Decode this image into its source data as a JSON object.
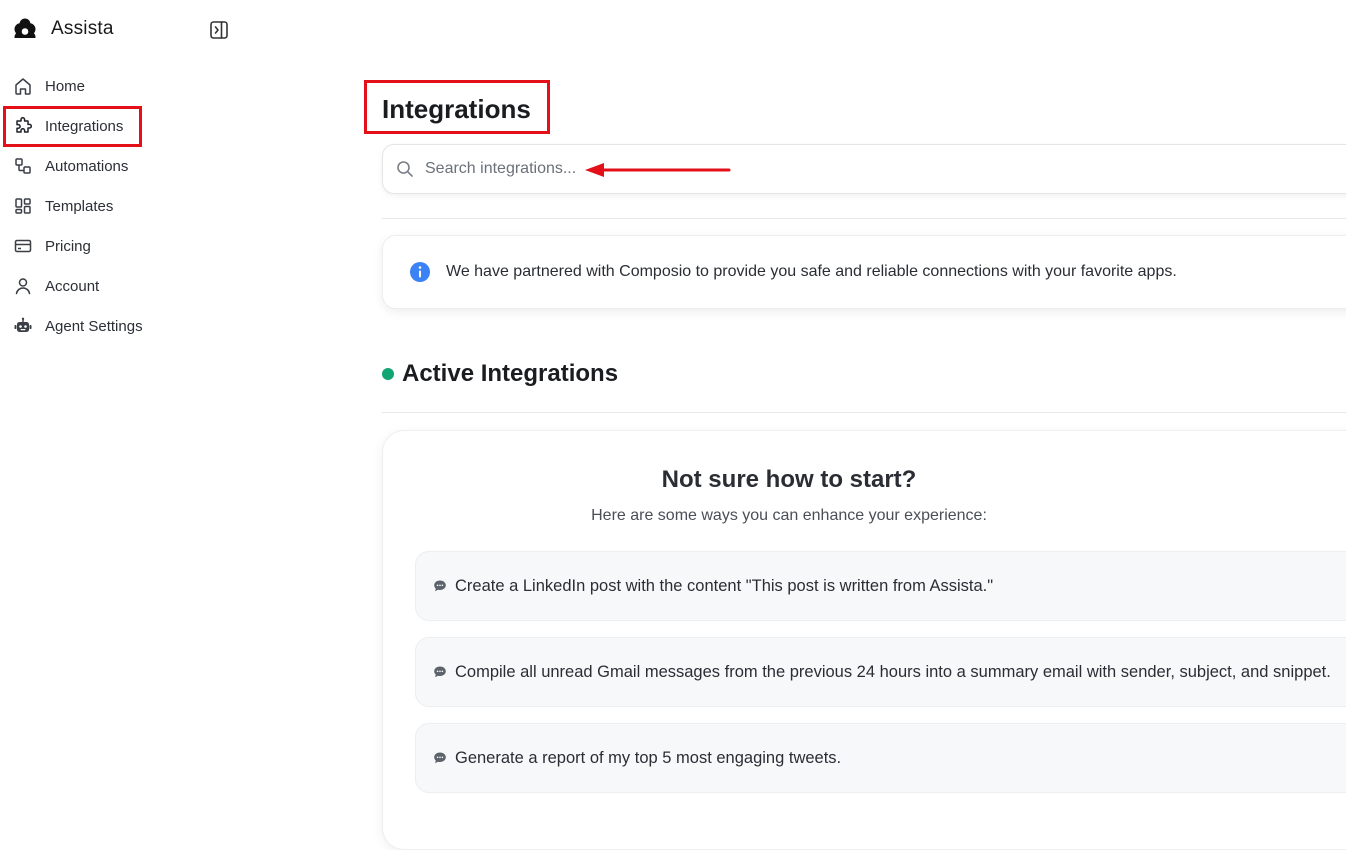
{
  "app": {
    "name": "Assista"
  },
  "sidebar": {
    "items": [
      {
        "label": "Home",
        "icon": "home-icon"
      },
      {
        "label": "Integrations",
        "icon": "puzzle-icon",
        "active": true
      },
      {
        "label": "Automations",
        "icon": "workflow-icon"
      },
      {
        "label": "Templates",
        "icon": "layout-grid-icon"
      },
      {
        "label": "Pricing",
        "icon": "credit-card-icon"
      },
      {
        "label": "Account",
        "icon": "user-icon"
      },
      {
        "label": "Agent Settings",
        "icon": "robot-icon"
      }
    ]
  },
  "main": {
    "title": "Integrations",
    "search": {
      "placeholder": "Search integrations...",
      "value": ""
    },
    "info_banner": "We have partnered with Composio to provide you safe and reliable connections with your favorite apps.",
    "active_section": {
      "title": "Active Integrations",
      "status_color": "#12a574"
    },
    "empty_state": {
      "title": "Not sure how to start?",
      "subtitle": "Here are some ways you can enhance your experience:",
      "suggestions": [
        "Create a LinkedIn post with the content \"This post is written from Assista.\"",
        "Compile all unread Gmail messages from the previous 24 hours into a summary email with sender, subject, and snippet.",
        "Generate a report of my top 5 most engaging tweets."
      ]
    }
  },
  "colors": {
    "highlight": "#e3101a",
    "info_icon": "#3b82f6",
    "accent_dot": "#12a574"
  }
}
